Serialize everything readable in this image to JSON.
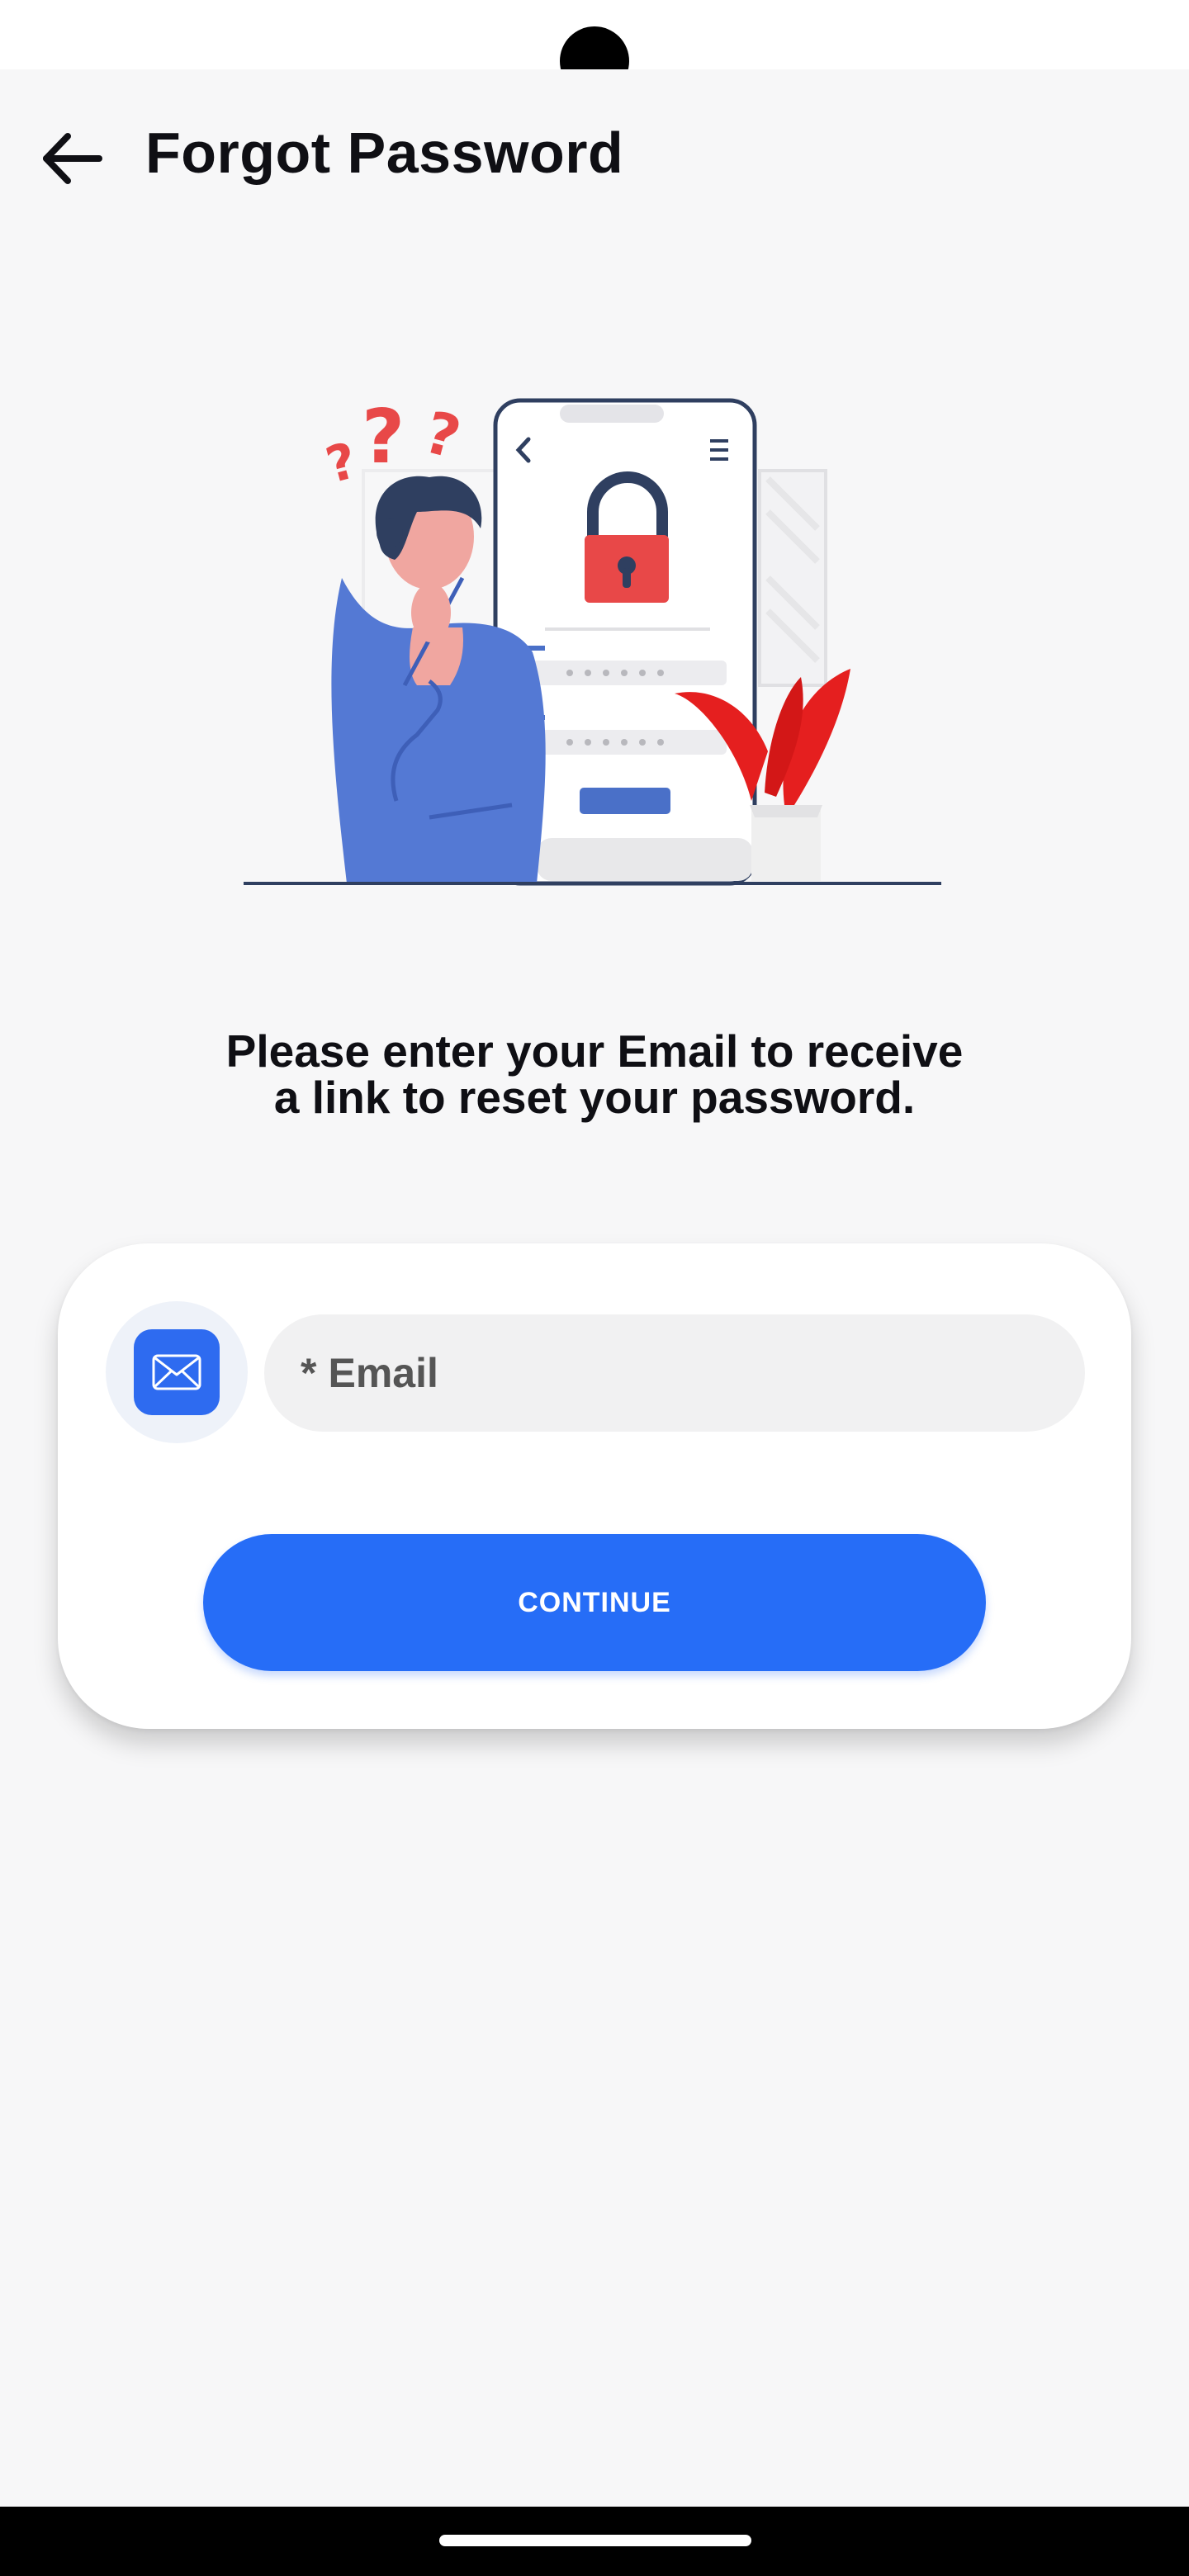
{
  "app_bar": {
    "title": "Forgot Password"
  },
  "illustration": {
    "question_marks": [
      "?",
      "?",
      "?"
    ]
  },
  "instruction": {
    "line1": "Please enter your Email to receive",
    "line2": "a link to reset your password."
  },
  "form": {
    "email_required_mark": "*",
    "email_placeholder": "Email",
    "continue_label": "CONTINUE"
  },
  "colors": {
    "accent": "#266df7",
    "background": "#f7f7f8",
    "lock_red": "#e84848",
    "plant_red": "#e51f1f",
    "person_blue": "#5479d4"
  }
}
